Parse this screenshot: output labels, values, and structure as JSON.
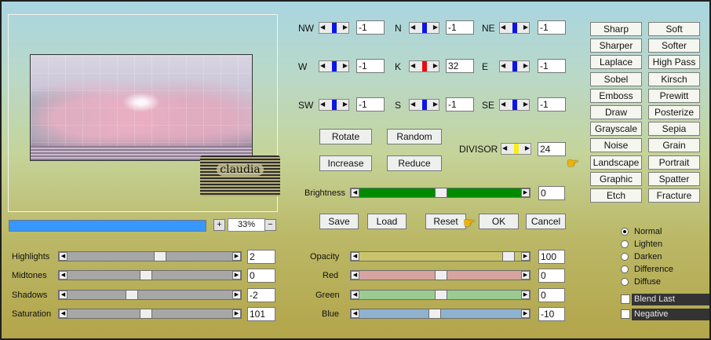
{
  "preview": {
    "watermark_text": "claudia",
    "zoom_minus": "−",
    "zoom_plus": "+",
    "zoom": "33%"
  },
  "progress": {
    "fill_fraction": 1.0
  },
  "adjust": [
    {
      "label": "Highlights",
      "value": "2",
      "level": 0.56
    },
    {
      "label": "Midtones",
      "value": "0",
      "level": 0.47
    },
    {
      "label": "Shadows",
      "value": "-2",
      "level": 0.38
    },
    {
      "label": "Saturation",
      "value": "101",
      "level": 0.47
    }
  ],
  "matrix": [
    {
      "label": "NW",
      "value": "-1"
    },
    {
      "label": "N",
      "value": "-1"
    },
    {
      "label": "NE",
      "value": "-1"
    },
    {
      "label": "W",
      "value": "-1"
    },
    {
      "label": "K",
      "value": "32"
    },
    {
      "label": "E",
      "value": "-1"
    },
    {
      "label": "SW",
      "value": "-1"
    },
    {
      "label": "S",
      "value": "-1"
    },
    {
      "label": "SE",
      "value": "-1"
    }
  ],
  "buttons": {
    "rotate": "Rotate",
    "random": "Random",
    "increase": "Increase",
    "reduce": "Reduce",
    "save": "Save",
    "load": "Load",
    "reset": "Reset",
    "ok": "OK",
    "cancel": "Cancel"
  },
  "divisor": {
    "label": "DIVISOR",
    "value": "24"
  },
  "brightness": {
    "label": "Brightness",
    "value": "0",
    "level": 0.5,
    "color": "#008a00"
  },
  "color_sliders": [
    {
      "label": "Opacity",
      "value": "100",
      "level": 0.95,
      "color": "#c9c46a"
    },
    {
      "label": "Red",
      "value": "0",
      "level": 0.5,
      "color": "#d6a3a0"
    },
    {
      "label": "Green",
      "value": "0",
      "level": 0.5,
      "color": "#9ccb92"
    },
    {
      "label": "Blue",
      "value": "-10",
      "level": 0.46,
      "color": "#8fb2cf"
    }
  ],
  "filters": [
    [
      "Sharp",
      "Soft"
    ],
    [
      "Sharper",
      "Softer"
    ],
    [
      "Laplace",
      "High Pass"
    ],
    [
      "Sobel",
      "Kirsch"
    ],
    [
      "Emboss",
      "Prewitt"
    ],
    [
      "Draw",
      "Posterize"
    ],
    [
      "Grayscale",
      "Sepia"
    ],
    [
      "Noise",
      "Grain"
    ],
    [
      "Landscape",
      "Portrait"
    ],
    [
      "Graphic",
      "Spatter"
    ],
    [
      "Etch",
      "Fracture"
    ]
  ],
  "blend_modes": [
    {
      "label": "Normal",
      "selected": true
    },
    {
      "label": "Lighten",
      "selected": false
    },
    {
      "label": "Darken",
      "selected": false
    },
    {
      "label": "Difference",
      "selected": false
    },
    {
      "label": "Diffuse",
      "selected": false
    }
  ],
  "options": {
    "blend_last": "Blend Last",
    "negative": "Negative"
  },
  "colors": {
    "progress": "#3597ff",
    "kernel_marker": "#0b16e6",
    "center_marker": "#e80c10",
    "divisor_marker": "#f6ee18"
  }
}
